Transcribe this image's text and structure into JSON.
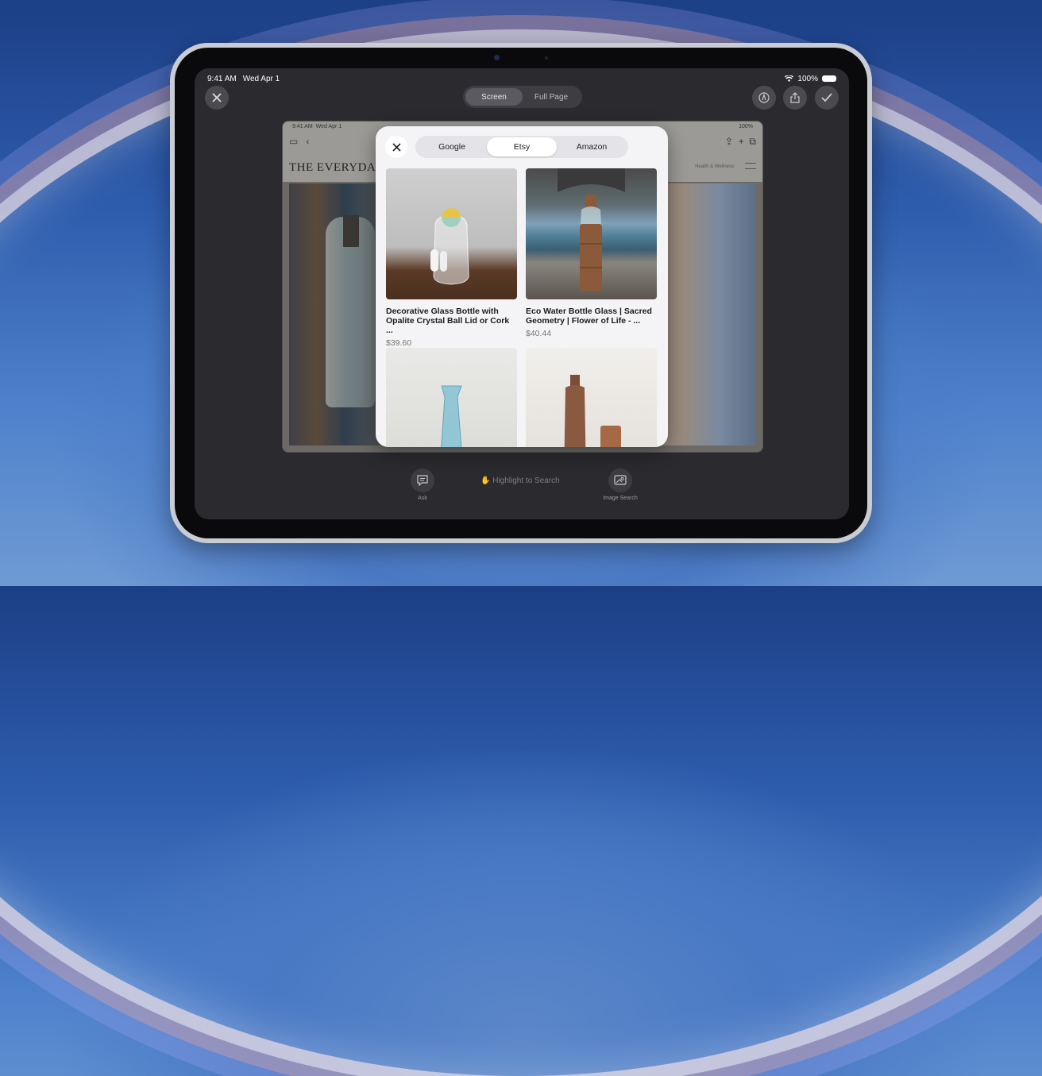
{
  "status": {
    "time": "9:41 AM",
    "date": "Wed Apr 1",
    "battery": "100%"
  },
  "capture": {
    "tabs": [
      "Screen",
      "Full Page"
    ],
    "active_tab": "Screen"
  },
  "inner": {
    "time": "9:41 AM",
    "date": "Wed Apr 1",
    "battery": "100%",
    "masthead": "THE EVERYDAY",
    "nav_item": "Health & Wellness"
  },
  "search_panel": {
    "tabs": [
      "Google",
      "Etsy",
      "Amazon"
    ],
    "active_tab": "Etsy",
    "results": [
      {
        "title": "Decorative Glass Bottle with Opalite Crystal Ball Lid or Cork ...",
        "price": "$39.60"
      },
      {
        "title": "Eco Water Bottle Glass | Sacred Geometry | Flower of Life - ...",
        "price": "$40.44"
      },
      {
        "title": "",
        "price": ""
      },
      {
        "title": "",
        "price": ""
      }
    ]
  },
  "bottom_bar": {
    "ask_label": "Ask",
    "highlight_label": "Highlight to Search",
    "image_search_label": "Image Search"
  }
}
